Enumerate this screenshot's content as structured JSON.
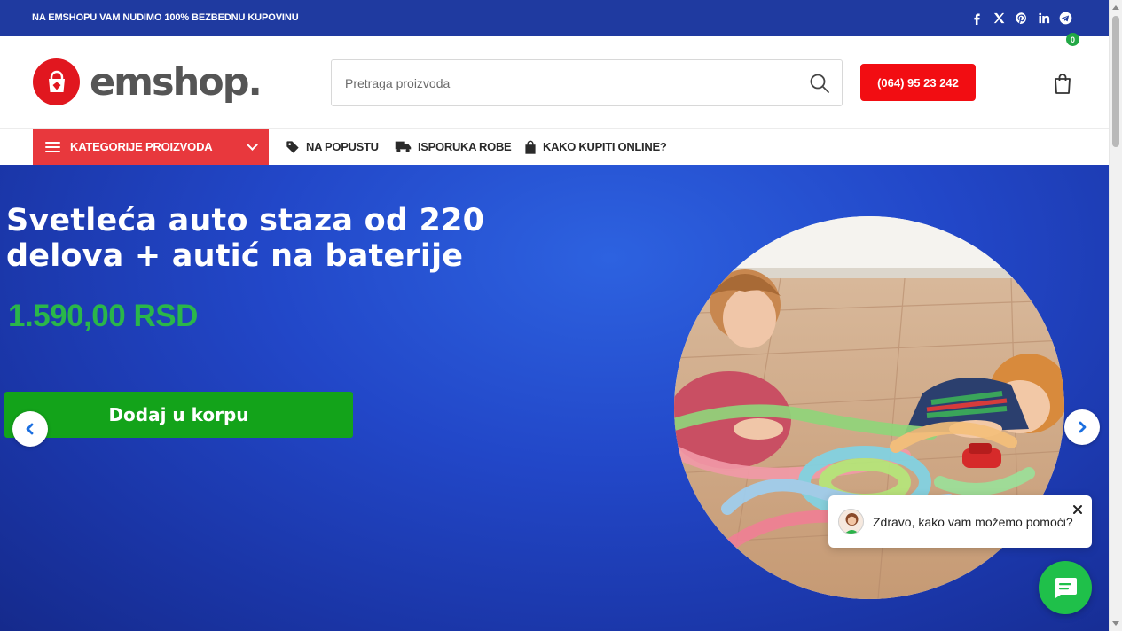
{
  "topbar": {
    "text": "NA EMSHOPU VAM NUDIMO 100% BEZBEDNU KUPOVINU",
    "socials": [
      "facebook-icon",
      "x-icon",
      "pinterest-icon",
      "linkedin-icon",
      "telegram-icon"
    ]
  },
  "header": {
    "logo_text": "emshop.",
    "search_placeholder": "Pretraga proizvoda",
    "phone_label": "(064) 95 23 242",
    "cart_count": "0"
  },
  "nav": {
    "categories_label": "KATEGORIJE PROIZVODA",
    "links": [
      {
        "label": "NA POPUSTU",
        "icon": "tag-icon"
      },
      {
        "label": "ISPORUKA ROBE",
        "icon": "truck-icon"
      },
      {
        "label": "KAKO KUPITI ONLINE?",
        "icon": "bag-icon"
      }
    ]
  },
  "hero": {
    "title": "Svetleća auto staza od 220 delova + autić na baterije",
    "price": "1.590,00 RSD",
    "cta_label": "Dodaj u korpu"
  },
  "chat": {
    "greeting": "Zdravo, kako vam možemo pomoći?"
  },
  "colors": {
    "topbar": "#1f3aa0",
    "brand_red": "#e1171f",
    "phone_button": "#f20d12",
    "category_button": "#e8383d",
    "price_green": "#2ab64a",
    "cta_green": "#13a31a",
    "chat_green": "#1fc04a"
  }
}
